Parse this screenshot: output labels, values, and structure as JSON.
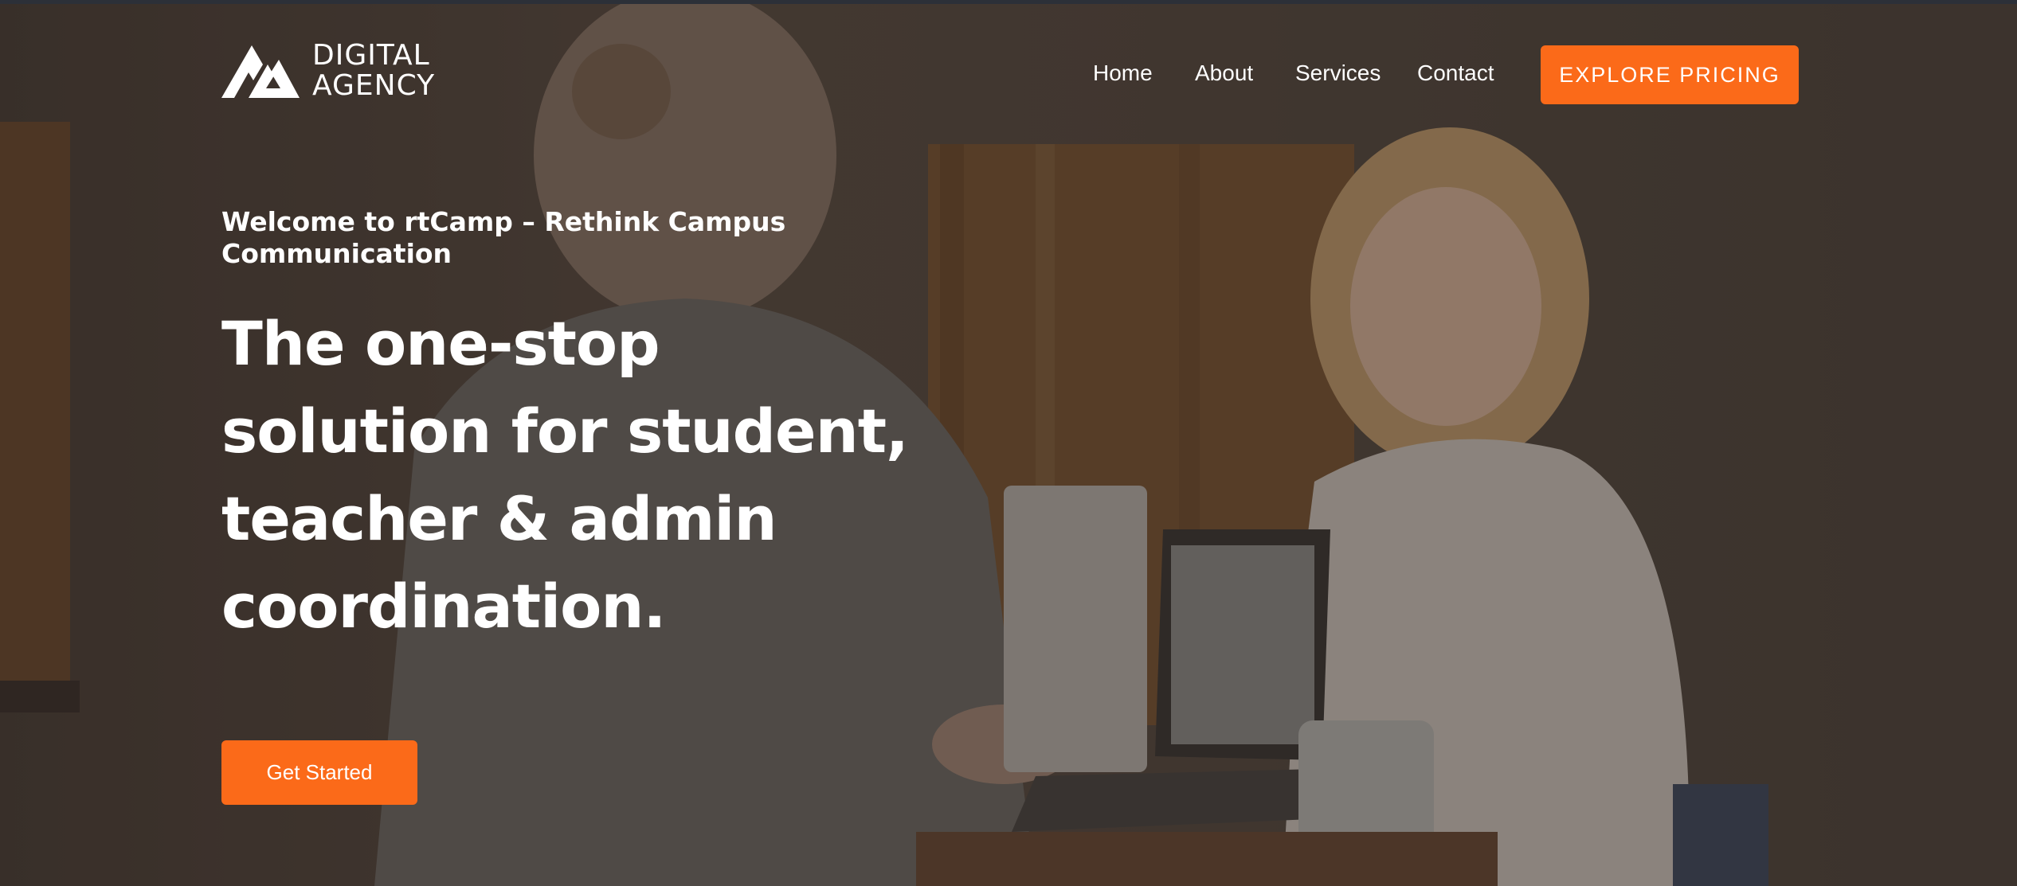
{
  "brand": {
    "line1": "DIGITAL",
    "line2": "AGENCY",
    "logo_icon": "mountain-logo-icon"
  },
  "nav": {
    "items": [
      {
        "label": "Home"
      },
      {
        "label": "About"
      },
      {
        "label": "Services"
      },
      {
        "label": "Contact"
      }
    ],
    "cta_label": "EXPLORE PRICING"
  },
  "hero": {
    "eyebrow": "Welcome to rtCamp – Rethink Campus Communication",
    "headline": "The one-stop solution for student, teacher & admin coordination.",
    "button_label": "Get Started",
    "background": "photo of two people laughing at a table with a laptop"
  },
  "colors": {
    "accent": "#fb6a19",
    "text": "#ffffff",
    "topbar": "#2c3038"
  }
}
